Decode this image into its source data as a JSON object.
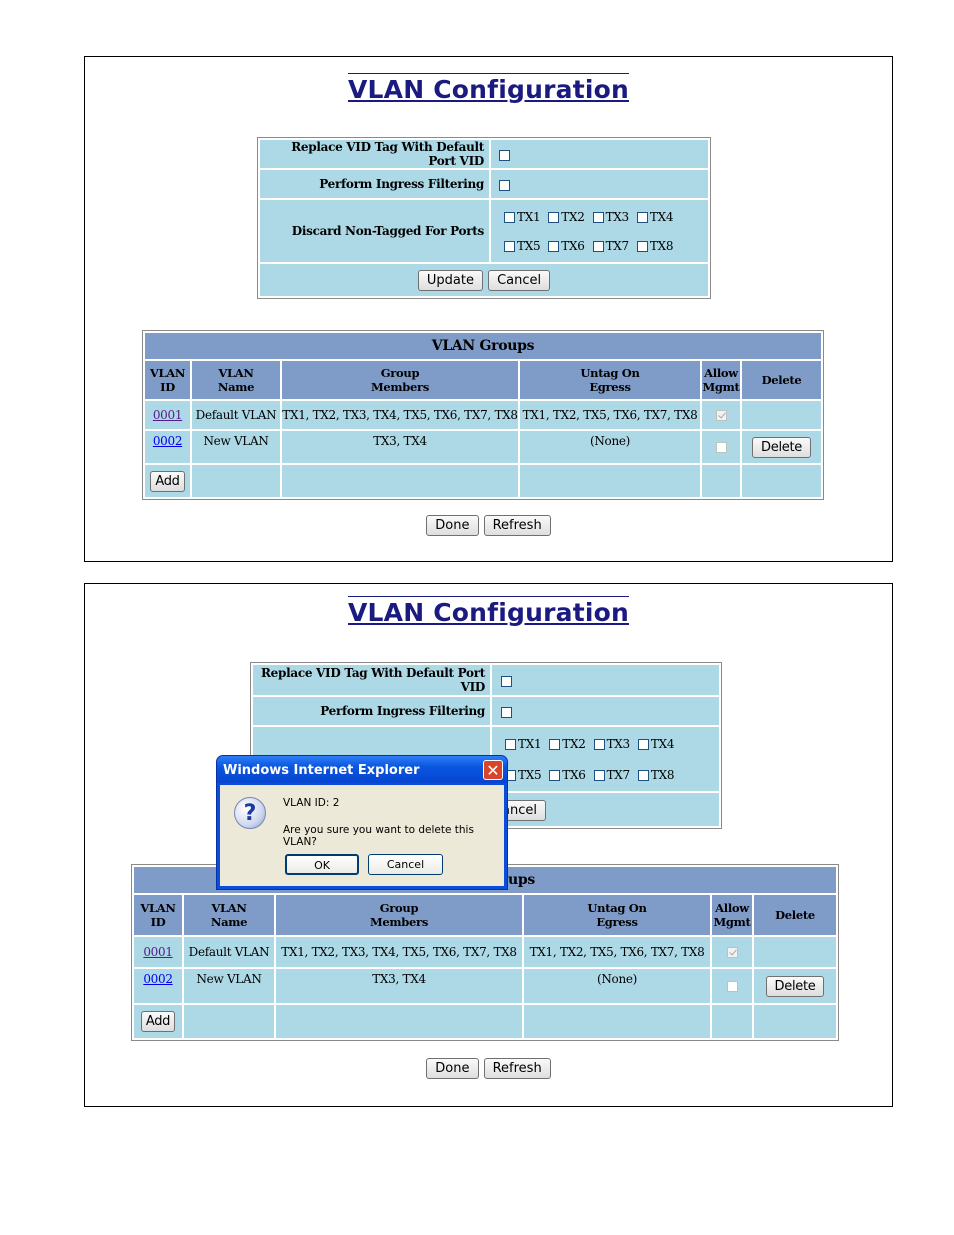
{
  "page_title": "VLAN Configuration",
  "config": {
    "replace_vid_label": "Replace VID Tag With Default Port VID",
    "ingress_label": "Perform Ingress Filtering",
    "discard_label": "Discard Non-Tagged For Ports",
    "ports": [
      "TX1",
      "TX2",
      "TX3",
      "TX4",
      "TX5",
      "TX6",
      "TX7",
      "TX8"
    ],
    "update_button": "Update",
    "cancel_button": "Cancel"
  },
  "groups": {
    "title": "VLAN Groups",
    "title_partial": "ups",
    "headers": {
      "vlan_id": [
        "VLAN",
        "ID"
      ],
      "vlan_name": [
        "VLAN",
        "Name"
      ],
      "group_members": [
        "Group",
        "Members"
      ],
      "untag": [
        "Untag On",
        "Egress"
      ],
      "allow_mgmt": [
        "Allow",
        "Mgmt"
      ],
      "delete": "Delete"
    },
    "rows": [
      {
        "id": "0001",
        "name": "Default VLAN",
        "members": "TX1, TX2, TX3, TX4, TX5, TX6, TX7, TX8",
        "untag": "TX1, TX2, TX5, TX6, TX7, TX8",
        "allow_mgmt": true,
        "delete": ""
      },
      {
        "id": "0002",
        "name": "New VLAN",
        "members": "TX3, TX4",
        "untag": "(None)",
        "allow_mgmt": false,
        "delete": "Delete"
      }
    ],
    "add_button": "Add"
  },
  "footer": {
    "done_button": "Done",
    "refresh_button": "Refresh"
  },
  "dialog": {
    "title": "Windows Internet Explorer",
    "line1": "VLAN ID:  2",
    "line2": "Are you sure you want to delete this VLAN?",
    "ok": "OK",
    "cancel": "Cancel",
    "partial_cancel": "ancel"
  }
}
